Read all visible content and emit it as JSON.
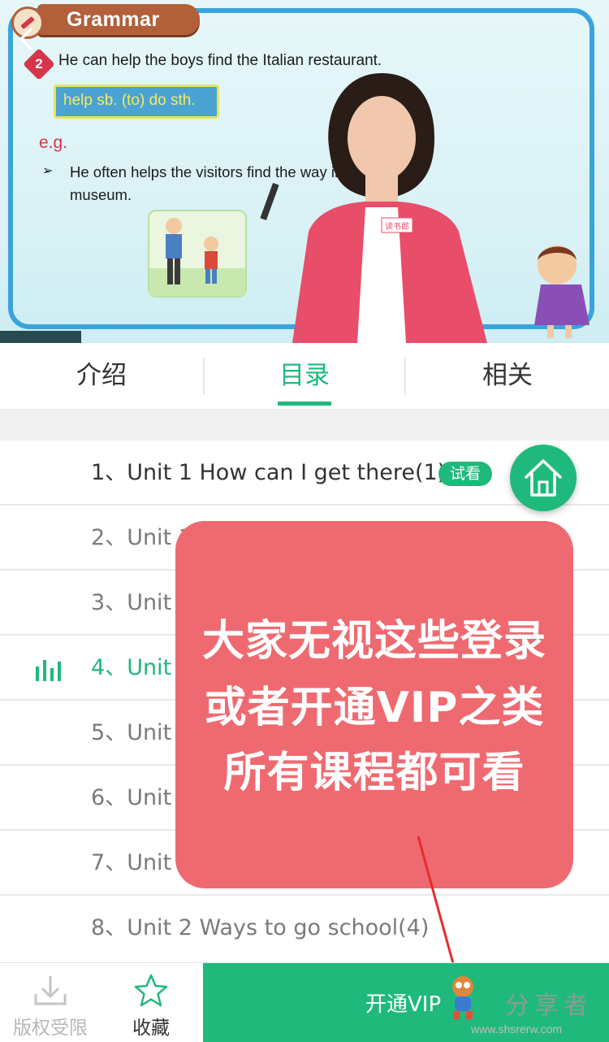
{
  "video": {
    "slide_title": "Grammar",
    "point_number": "2",
    "sentence": "He can help the boys find the Italian restaurant.",
    "pattern": "help sb. (to) do sth.",
    "eg_label": "e.g.",
    "bullet": "➢",
    "example": "He often helps the visitors find the way in the museum.",
    "badge_text": "读书郎",
    "back_icon": "chevron-left-icon"
  },
  "tabs": [
    {
      "label": "介绍",
      "active": false
    },
    {
      "label": "目录",
      "active": true
    },
    {
      "label": "相关",
      "active": false
    }
  ],
  "lessons": [
    {
      "index": "1、",
      "title": "Unit 1 How can I get there(1)",
      "trial": "试看"
    },
    {
      "index": "2、",
      "title": "Unit 1"
    },
    {
      "index": "3、",
      "title": "Unit"
    },
    {
      "index": "4、",
      "title": "Unit",
      "playing": true
    },
    {
      "index": "5、",
      "title": "Unit"
    },
    {
      "index": "6、",
      "title": "Unit"
    },
    {
      "index": "7、",
      "title": "Unit 2"
    },
    {
      "index": "8、",
      "title": "Unit 2 Ways to go school(4)"
    }
  ],
  "overlay": {
    "line1": "大家无视这些登录",
    "line2": "或者开通VIP之类",
    "line3": "所有课程都可看"
  },
  "bottom_bar": {
    "download_label": "版权受限",
    "favorite_label": "收藏",
    "vip_label": "开通VIP"
  },
  "watermark": {
    "text": "分享者",
    "url": "www.shsrerw.com"
  },
  "colors": {
    "accent": "#1fb97c",
    "overlay": "#ef6a70",
    "slide_frame": "#3aa3dc"
  }
}
